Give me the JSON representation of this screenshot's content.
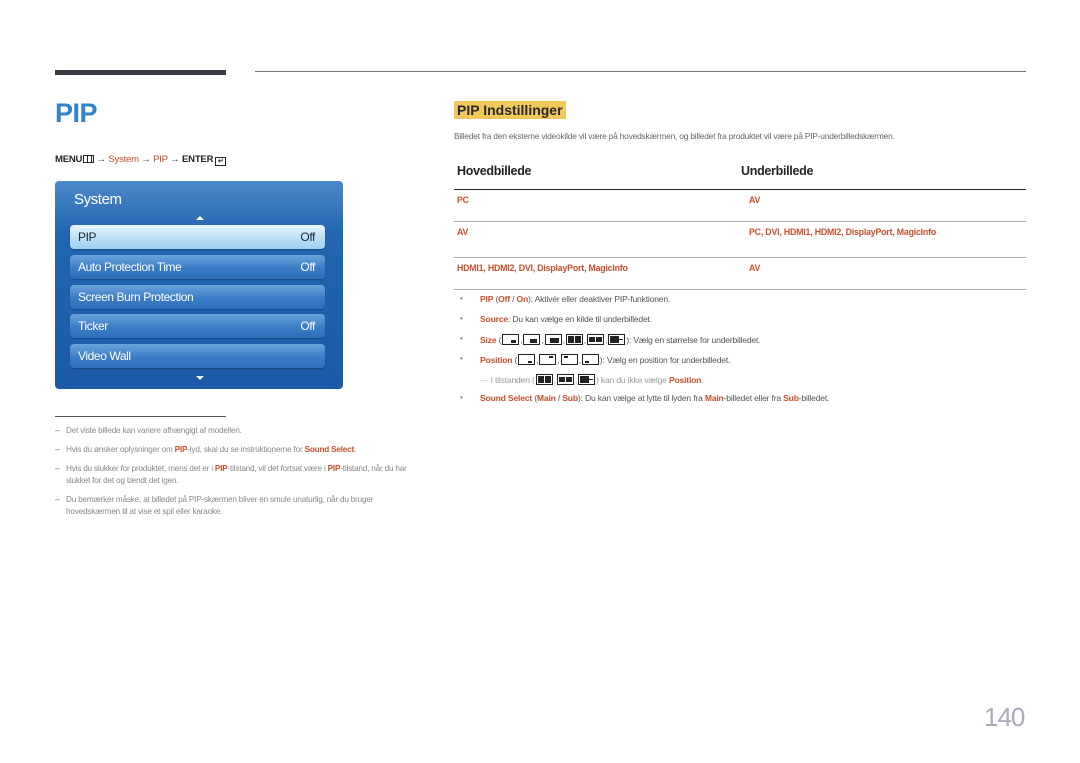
{
  "page_title": "PIP",
  "menu_path": {
    "menu": "MENU",
    "arrow": "→",
    "system": "System",
    "pip": "PIP",
    "enter": "ENTER",
    "menu_icon": "menu-grid-icon",
    "enter_icon": "enter-icon"
  },
  "osd": {
    "title": "System",
    "items": [
      {
        "label": "PIP",
        "value": "Off",
        "selected": true
      },
      {
        "label": "Auto Protection Time",
        "value": "Off"
      },
      {
        "label": "Screen Burn Protection",
        "value": ""
      },
      {
        "label": "Ticker",
        "value": "Off"
      },
      {
        "label": "Video Wall",
        "value": ""
      }
    ]
  },
  "notes": [
    {
      "text": "Det viste billede kan variere afhængigt af modellen."
    },
    {
      "pre": "Hvis du ønsker oplysninger om ",
      "hl1": "PIP",
      "mid": "-lyd, skal du se instruktionerne for ",
      "hl2": "Sound Select",
      "post": "."
    },
    {
      "pre": "Hvis du slukker for produktet, mens det er i ",
      "hl1": "PIP",
      "mid": "-tilstand, vil det fortsat være i ",
      "hl2": "PIP",
      "post": "-tilstand, når du har slukket for det og tændt det igen."
    },
    {
      "text": "Du bemærker måske, at billedet på PIP-skærmen bliver en smule unaturlig, når du bruger hovedskærmen til at vise et spil eller karaoke."
    }
  ],
  "section": {
    "title": "PIP Indstillinger",
    "intro": "Billedet fra den eksterne videokilde vil være på hovedskærmen, og billedet fra produktet vil være på PIP-underbilledskærmen."
  },
  "table": {
    "headers": [
      "Hovedbillede",
      "Underbillede"
    ],
    "rows": [
      [
        "PC",
        "AV"
      ],
      [
        "AV",
        "PC, DVI, HDMI1, HDMI2, DisplayPort, MagicInfo"
      ],
      [
        "HDMI1, HDMI2, DVI, DisplayPort, MagicInfo",
        "AV"
      ]
    ]
  },
  "bullets": {
    "pip": {
      "label": "PIP",
      "open": " (",
      "off": "Off",
      "sep": " / ",
      "on": "On",
      "close": ")",
      "desc": ": Aktivér eller deaktiver PIP-funktionen."
    },
    "source": {
      "label": "Source",
      "desc": ": Du kan vælge en kilde til underbilledet."
    },
    "size": {
      "label": "Size",
      "open": " (",
      "close": ")",
      "desc": ": Vælg en størrelse for underbilledet.",
      "icons": [
        "pip-small-icon",
        "pip-medium-icon",
        "pip-large-icon",
        "split-equal-icon",
        "split-wide-icon",
        "pip-side-icon"
      ]
    },
    "position": {
      "label": "Position",
      "open": " (",
      "close": ")",
      "desc": ": Vælg en position for underbilledet.",
      "icons": [
        "position-bottom-right-icon",
        "position-top-right-icon",
        "position-top-left-icon",
        "position-bottom-left-icon"
      ]
    },
    "subnote": {
      "pre": "I tilstanden (",
      "post": ") kan du ikke vælge ",
      "hl": "Position",
      "end": "."
    },
    "sound": {
      "label": "Sound Select",
      "open": " (",
      "main": "Main",
      "sep": " / ",
      "sub": "Sub",
      "close": ")",
      "desc1": ": Du kan vælge at lytte til lyden fra ",
      "main2": "Main",
      "desc2": "-billedet eller fra ",
      "sub2": "Sub",
      "desc3": "-billedet."
    }
  },
  "page_number": "140",
  "colors": {
    "accent": "#c8502a",
    "title_blue": "#2e85c7",
    "highlight": "#f0c95a",
    "osd_blue": "#1c5aa8"
  }
}
